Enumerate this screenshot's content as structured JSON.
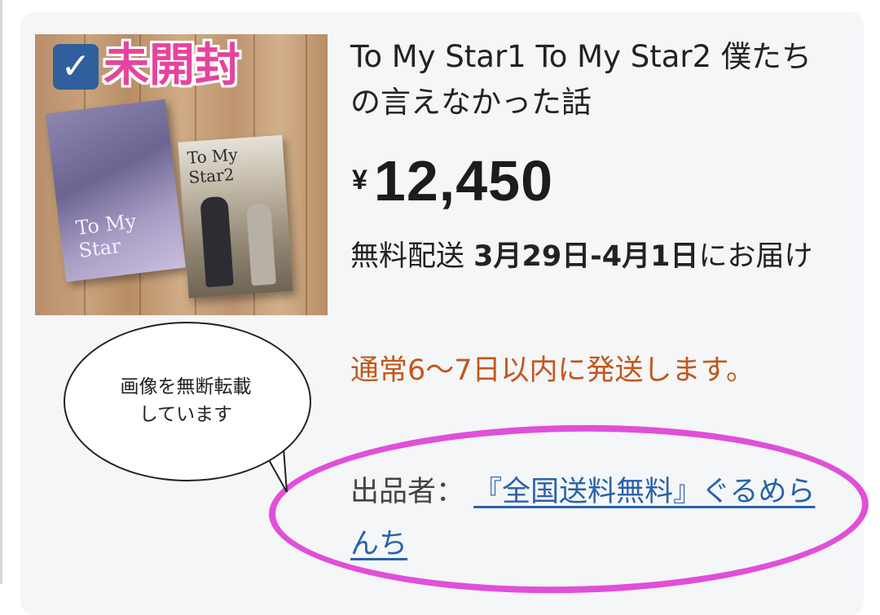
{
  "product": {
    "title": "To My Star1 To My Star2 僕たちの言えなかった話",
    "currency": "¥",
    "price": "12,450",
    "delivery_prefix": "無料配送 ",
    "delivery_dates": "3月29日-4月1日",
    "delivery_suffix": "にお届け",
    "ship_note": "通常6～7日以内に発送します。",
    "seller_label": "出品者：",
    "seller_name": "『全国送料無料』ぐるめらんち"
  },
  "image": {
    "badge_check": "✓",
    "badge_label": "未開封",
    "box1_title": "To My Star",
    "box2_title": "To My Star2"
  },
  "annotation": {
    "bubble_text": "画像を無断転載\nしています"
  },
  "colors": {
    "ship_note": "#c4561b",
    "seller_link": "#2a62a8",
    "oval": "#e04fd8",
    "badge_label": "#e6449c",
    "checkbox": "#2f5f9c"
  }
}
